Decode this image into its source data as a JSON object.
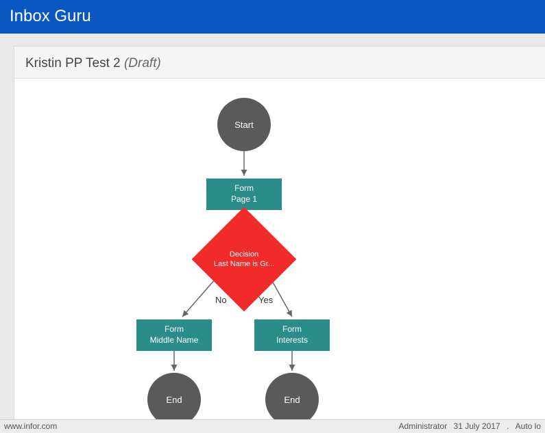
{
  "header": {
    "title": "Inbox Guru"
  },
  "page": {
    "name": "Kristin PP Test 2",
    "status": "(Draft)"
  },
  "flow": {
    "start": "Start",
    "form1_line1": "Form",
    "form1_line2": "Page 1",
    "decision_line1": "Decision",
    "decision_line2": "Last Name is Gr...",
    "no_label": "No",
    "yes_label": "Yes",
    "form_left_line1": "Form",
    "form_left_line2": "Middle Name",
    "form_right_line1": "Form",
    "form_right_line2": "Interests",
    "end_left": "End",
    "end_right": "End"
  },
  "footer": {
    "url": "www.infor.com",
    "user": "Administrator",
    "date": "31 July 2017",
    "sep": ".",
    "auto": "Auto lo"
  }
}
